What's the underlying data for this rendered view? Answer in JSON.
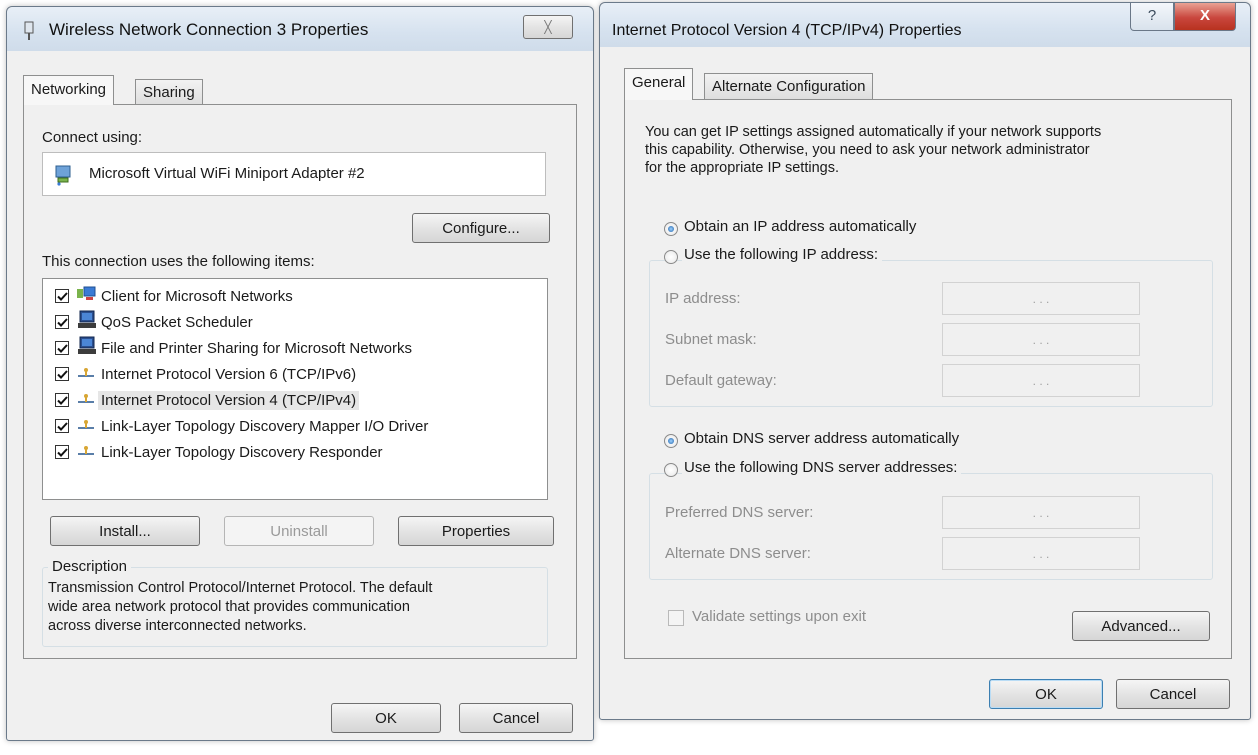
{
  "left_dialog": {
    "title": "Wireless Network Connection 3 Properties",
    "tabs": [
      {
        "label": "Networking",
        "active": true
      },
      {
        "label": "Sharing",
        "active": false
      }
    ],
    "connect_using_label": "Connect using:",
    "adapter_name": "Microsoft Virtual WiFi Miniport Adapter #2",
    "configure_button": "Configure...",
    "items_label": "This connection uses the following items:",
    "items": [
      {
        "label": "Client for Microsoft Networks",
        "checked": true,
        "icon": "network-client-icon"
      },
      {
        "label": "QoS Packet Scheduler",
        "checked": true,
        "icon": "computer-service-icon"
      },
      {
        "label": "File and Printer Sharing for Microsoft Networks",
        "checked": true,
        "icon": "computer-service-icon"
      },
      {
        "label": "Internet Protocol Version 6 (TCP/IPv6)",
        "checked": true,
        "icon": "protocol-icon"
      },
      {
        "label": "Internet Protocol Version 4 (TCP/IPv4)",
        "checked": true,
        "icon": "protocol-icon",
        "selected": true
      },
      {
        "label": "Link-Layer Topology Discovery Mapper I/O Driver",
        "checked": true,
        "icon": "protocol-icon"
      },
      {
        "label": "Link-Layer Topology Discovery Responder",
        "checked": true,
        "icon": "protocol-icon"
      }
    ],
    "install_button": "Install...",
    "uninstall_button": "Uninstall",
    "properties_button": "Properties",
    "description_label": "Description",
    "description_lines": [
      "Transmission Control Protocol/Internet Protocol. The default",
      "wide area network protocol that provides communication",
      "across diverse interconnected networks."
    ],
    "ok_button": "OK",
    "cancel_button": "Cancel",
    "close_glyph": "╳"
  },
  "right_dialog": {
    "title": "Internet Protocol Version 4 (TCP/IPv4) Properties",
    "help_glyph": "?",
    "close_glyph": "X",
    "tabs": [
      {
        "label": "General",
        "active": true
      },
      {
        "label": "Alternate Configuration",
        "active": false
      }
    ],
    "intro_lines": [
      "You can get IP settings assigned automatically if your network supports",
      "this capability. Otherwise, you need to ask your network administrator",
      "for the appropriate IP settings."
    ],
    "ip_auto_radio": {
      "label": "Obtain an IP address automatically",
      "selected": true
    },
    "ip_manual_radio": {
      "label": "Use the following IP address:",
      "selected": false
    },
    "ip_fields": [
      {
        "label": "IP address:",
        "value": ". . ."
      },
      {
        "label": "Subnet mask:",
        "value": ". . ."
      },
      {
        "label": "Default gateway:",
        "value": ". . ."
      }
    ],
    "dns_auto_radio": {
      "label": "Obtain DNS server address automatically",
      "selected": true
    },
    "dns_manual_radio": {
      "label": "Use the following DNS server addresses:",
      "selected": false
    },
    "dns_fields": [
      {
        "label": "Preferred DNS server:",
        "value": ". . ."
      },
      {
        "label": "Alternate DNS server:",
        "value": ". . ."
      }
    ],
    "validate_label": "Validate settings upon exit",
    "advanced_button": "Advanced...",
    "ok_button": "OK",
    "cancel_button": "Cancel"
  },
  "colors": {
    "dialog_bg": "#f0f0f0",
    "selection_bg": "#e6e6e6",
    "close_red": "#c9463d",
    "disabled_text": "#8d8d8d"
  }
}
